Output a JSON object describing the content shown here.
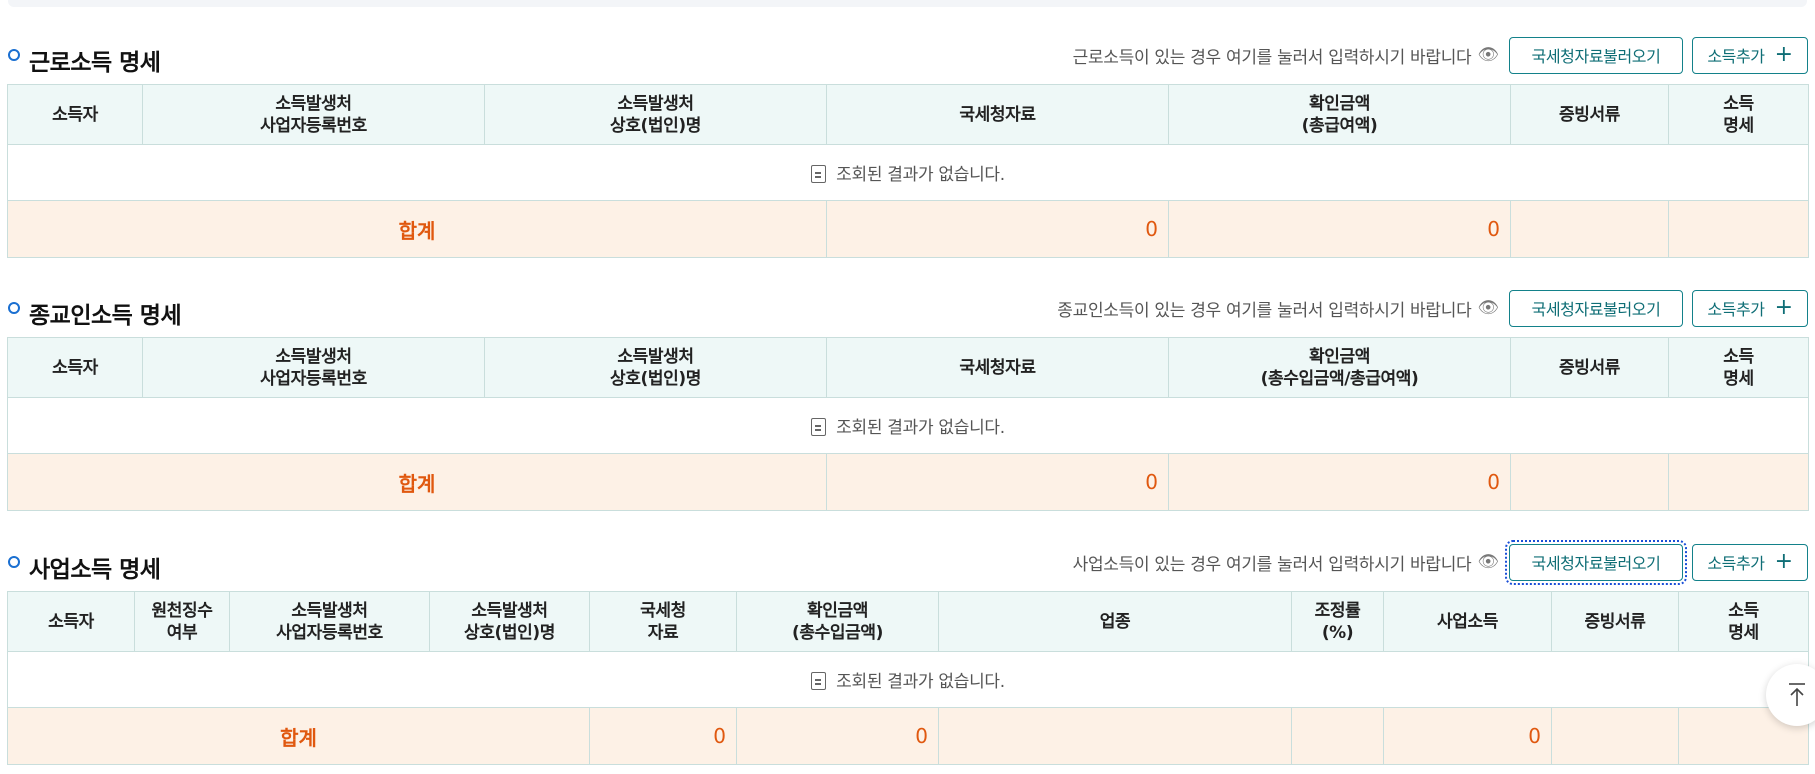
{
  "sections": [
    {
      "title": "근로소득 명세",
      "hint": "근로소득이 있는 경우 여기를 눌러서 입력하시기 바랍니다",
      "btn_nts": "국세청자료불러오기",
      "btn_add": "소득추가",
      "headers": [
        "소득자",
        "소득발생처\n사업자등록번호",
        "소득발생처\n상호(법인)명",
        "국세청자료",
        "확인금액\n(총급여액)",
        "증빙서류",
        "소득\n명세"
      ],
      "empty": "조회된 결과가 없습니다.",
      "total_label": "합계",
      "totals": [
        "0",
        "0"
      ]
    },
    {
      "title": "종교인소득 명세",
      "hint": "종교인소득이 있는 경우 여기를 눌러서 입력하시기 바랍니다",
      "btn_nts": "국세청자료불러오기",
      "btn_add": "소득추가",
      "headers": [
        "소득자",
        "소득발생처\n사업자등록번호",
        "소득발생처\n상호(법인)명",
        "국세청자료",
        "확인금액\n(총수입금액/총급여액)",
        "증빙서류",
        "소득\n명세"
      ],
      "empty": "조회된 결과가 없습니다.",
      "total_label": "합계",
      "totals": [
        "0",
        "0"
      ]
    },
    {
      "title": "사업소득 명세",
      "hint": "사업소득이 있는 경우 여기를 눌러서 입력하시기 바랍니다",
      "btn_nts": "국세청자료불러오기",
      "btn_add": "소득추가",
      "headers": [
        "소득자",
        "원천징수\n여부",
        "소득발생처\n사업자등록번호",
        "소득발생처\n상호(법인)명",
        "국세청\n자료",
        "확인금액\n(총수입금액)",
        "업종",
        "조정률\n(%)",
        "사업소득",
        "증빙서류",
        "소득\n명세"
      ],
      "empty": "조회된 결과가 없습니다.",
      "total_label": "합계",
      "totals": [
        "0",
        "0",
        "0"
      ]
    }
  ],
  "colors": {
    "accent": "#13818a",
    "bullet": "#1a6fd1",
    "total": "#e0580f",
    "total_bg": "#fdf1e6",
    "header_bg": "#eef8f7"
  },
  "icons": {
    "hint": "eye-icon",
    "empty": "document-icon",
    "add": "plus-icon",
    "scroll": "arrow-up-to-top-icon"
  }
}
